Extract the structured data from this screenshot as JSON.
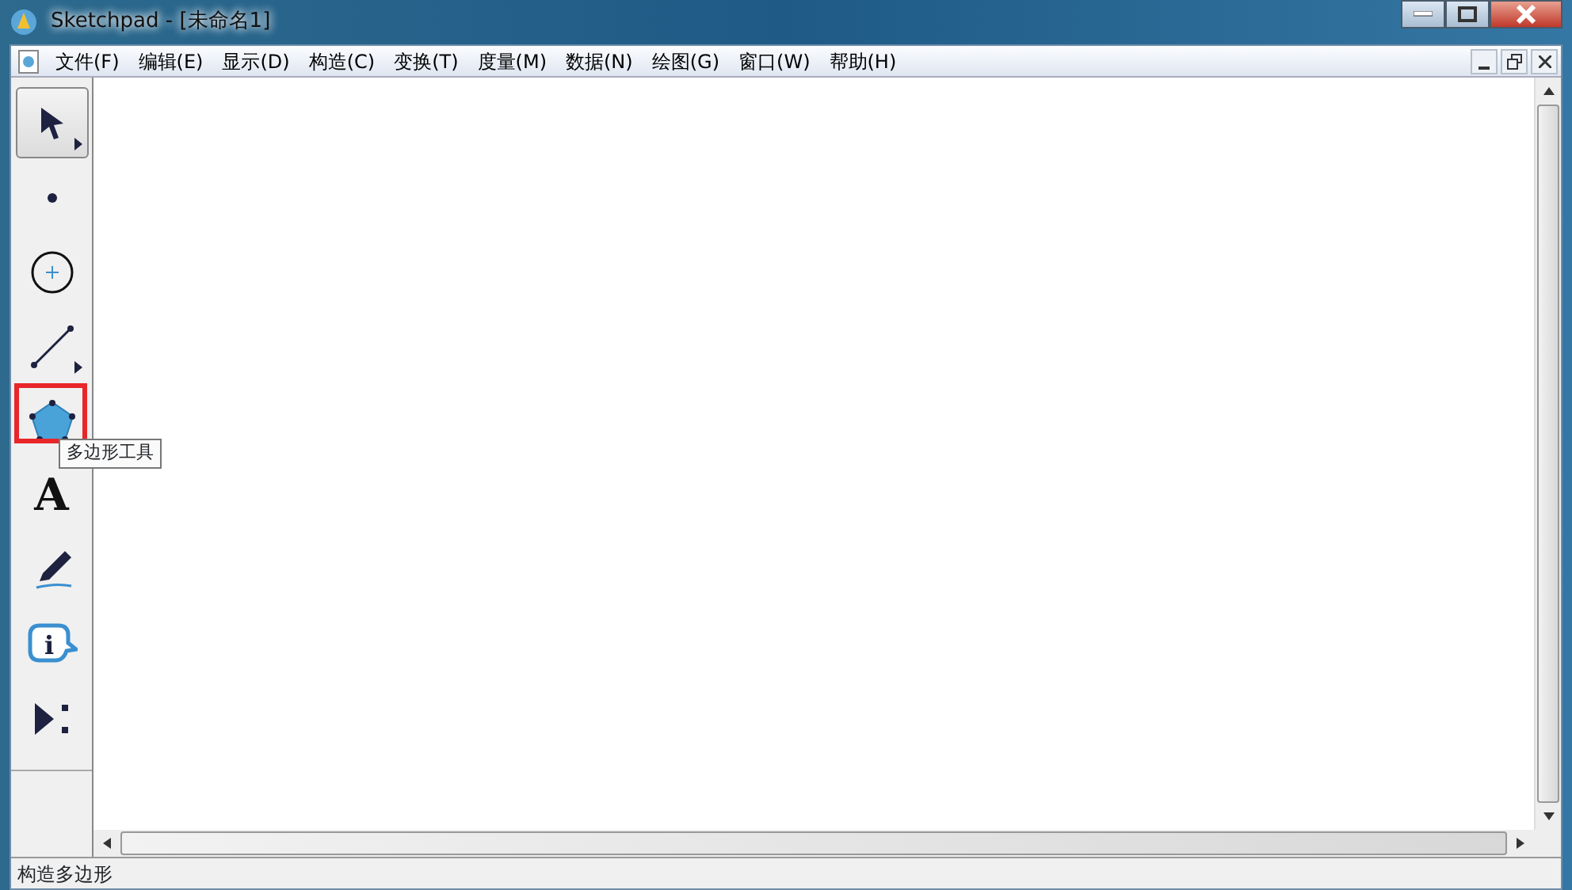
{
  "window": {
    "title": "Sketchpad  - [未命名1]"
  },
  "menu": [
    "文件(F)",
    "编辑(E)",
    "显示(D)",
    "构造(C)",
    "变换(T)",
    "度量(M)",
    "数据(N)",
    "绘图(G)",
    "窗口(W)",
    "帮助(H)"
  ],
  "toolbox": {
    "tools": [
      {
        "kind": "arrow",
        "selected": true,
        "submenu": true
      },
      {
        "kind": "point",
        "selected": false,
        "submenu": false
      },
      {
        "kind": "compass",
        "selected": false,
        "submenu": false
      },
      {
        "kind": "line",
        "selected": false,
        "submenu": true
      },
      {
        "kind": "polygon",
        "selected": false,
        "submenu": false,
        "highlighted": true
      },
      {
        "kind": "text",
        "selected": false,
        "submenu": false,
        "glyph": "A"
      },
      {
        "kind": "marker",
        "selected": false,
        "submenu": false
      },
      {
        "kind": "info",
        "selected": false,
        "submenu": false,
        "glyph": "i"
      },
      {
        "kind": "custom",
        "selected": false,
        "submenu": false
      }
    ],
    "tooltip": "多边形工具"
  },
  "status_bar": "构造多边形"
}
